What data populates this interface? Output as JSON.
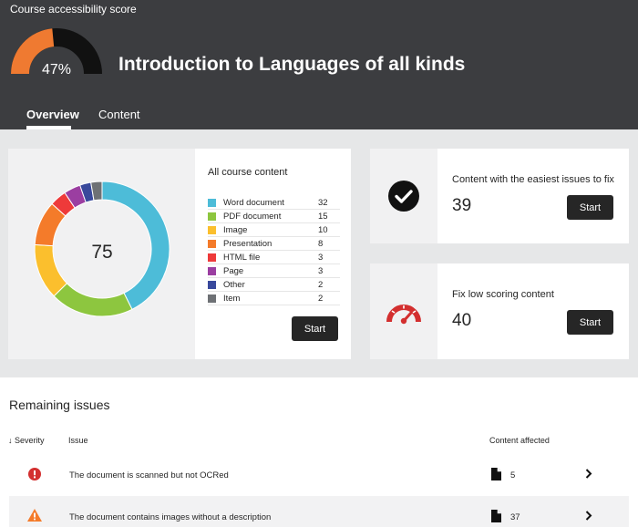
{
  "header": {
    "score_label": "Course accessibility score",
    "score_text": "47%",
    "score_fraction": 0.47,
    "course_title": "Introduction to Languages of all kinds",
    "tabs": [
      {
        "label": "Overview",
        "active": true
      },
      {
        "label": "Content",
        "active": false
      }
    ],
    "colors": {
      "gauge_fill": "#ef7a31",
      "gauge_track": "#111111",
      "background": "#3c3d40"
    }
  },
  "all_content": {
    "title": "All course content",
    "total": "75",
    "start_label": "Start",
    "items": [
      {
        "label": "Word document",
        "count": "32",
        "value": 32,
        "color": "#4dbcd8"
      },
      {
        "label": "PDF document",
        "count": "15",
        "value": 15,
        "color": "#8dc63f"
      },
      {
        "label": "Image",
        "count": "10",
        "value": 10,
        "color": "#fbbf2d"
      },
      {
        "label": "Presentation",
        "count": "8",
        "value": 8,
        "color": "#f47b2a"
      },
      {
        "label": "HTML file",
        "count": "3",
        "value": 3,
        "color": "#ee3a3a"
      },
      {
        "label": "Page",
        "count": "3",
        "value": 3,
        "color": "#9b3ea1"
      },
      {
        "label": "Other",
        "count": "2",
        "value": 2,
        "color": "#39499c"
      },
      {
        "label": "Item",
        "count": "2",
        "value": 2,
        "color": "#6e7175"
      }
    ]
  },
  "easy_fixes": {
    "label": "Content with the easiest issues to fix",
    "count": "39",
    "start_label": "Start",
    "icon": "check-circle-icon"
  },
  "low_scoring": {
    "label": "Fix low scoring content",
    "count": "40",
    "start_label": "Start",
    "icon": "gauge-icon",
    "icon_color": "#d32f2f"
  },
  "remaining_issues": {
    "title": "Remaining issues",
    "columns": {
      "severity": "Severity",
      "issue": "Issue",
      "affected": "Content affected"
    },
    "rows": [
      {
        "severity": "error",
        "issue": "The document is scanned but not OCRed",
        "affected": "5"
      },
      {
        "severity": "warning",
        "issue": "The document contains images without a description",
        "affected": "37"
      }
    ]
  }
}
